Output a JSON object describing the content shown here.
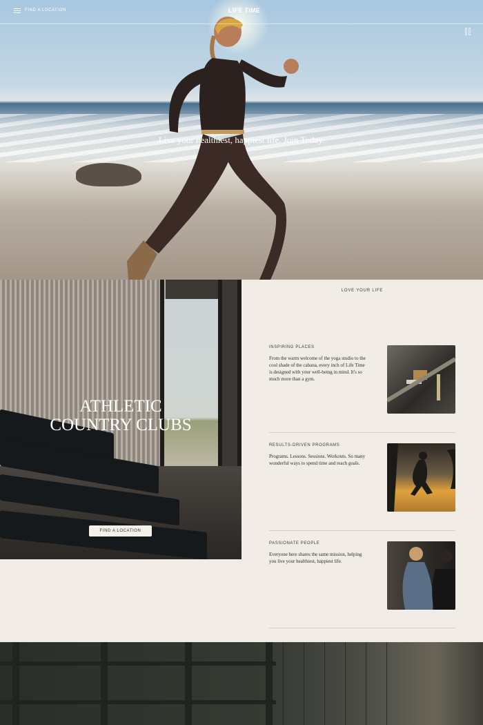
{
  "header": {
    "find_location": "FIND A LOCATION",
    "logo": "LIFE TIME"
  },
  "hero": {
    "tagline": "Live your healthiest, happiest life. Join Today."
  },
  "clubs": {
    "title_line1": "ATHLETIC",
    "title_line2": "COUNTRY CLUBS",
    "button": "FIND A LOCATION"
  },
  "love": {
    "heading": "LOVE YOUR LIFE",
    "features": [
      {
        "title": "INSPIRING PLACES",
        "desc": "From the warm welcome of the yoga studio to the cool shade of the cabana, every inch of Life Time is designed with your well-being in mind. It's so much more than a gym."
      },
      {
        "title": "RESULTS-DRIVEN PROGRAMS",
        "desc": "Programs. Lessons. Sessions. Workouts. So many wonderful ways to spend time and reach goals."
      },
      {
        "title": "PASSIONATE PEOPLE",
        "desc": "Everyone here shares the same mission, helping you live your healthiest, happiest life."
      }
    ]
  },
  "icons": [
    "menu-icon",
    "pause-icon"
  ],
  "colors": {
    "page_bg": "#f1ece6",
    "text": "#2b2b2b",
    "button_bg": "#f4f0ea"
  }
}
